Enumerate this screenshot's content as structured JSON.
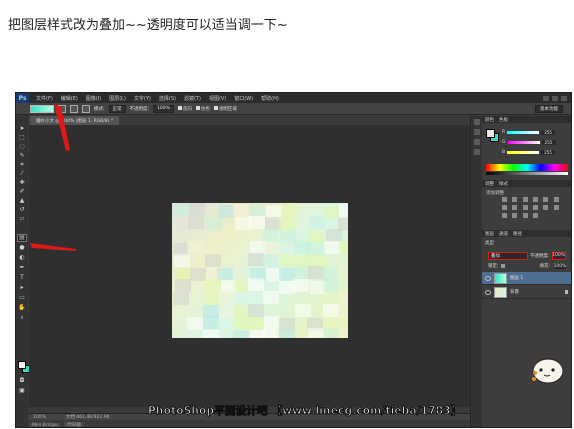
{
  "instruction_text": "把图层样式改为叠加~~透明度可以适当调一下~",
  "photoshop": {
    "logo": "Ps",
    "menu": [
      "文件(F)",
      "编辑(E)",
      "图像(I)",
      "图层(L)",
      "文字(Y)",
      "选择(S)",
      "滤镜(T)",
      "视图(V)",
      "窗口(W)",
      "帮助(H)"
    ],
    "options": {
      "mode_label": "模式:",
      "mode_value": "正常",
      "opacity_label": "不透明度:",
      "opacity_value": "100%",
      "reverse_label": "反向",
      "dither_label": "仿色",
      "transparency_label": "透明区域",
      "workspace": "基本功能"
    },
    "document_tab": "婚纱小文 @ 100% (图层 1, RGB/8) *",
    "status": {
      "zoom": "100%",
      "doc": "文档:461.4K/922.9K"
    },
    "bottom_tabs": [
      "Mini Bridge",
      "时间轴"
    ],
    "color_panel": {
      "tabs": [
        "颜色",
        "色板"
      ],
      "channels": [
        {
          "label": "R",
          "value": "255",
          "color": "#ff4b4b"
        },
        {
          "label": "G",
          "value": "255",
          "color": "#4bd44b"
        },
        {
          "label": "B",
          "value": "255",
          "color": "#4b6bff"
        }
      ]
    },
    "adjust_panel": {
      "tabs": [
        "调整",
        "样式"
      ],
      "title": "添加调整"
    },
    "layers_panel": {
      "tabs": [
        "图层",
        "通道",
        "路径"
      ],
      "kind_label": "类型",
      "blend_mode": "叠加",
      "opacity_label": "不透明度:",
      "opacity_value": "100%",
      "lock_label": "锁定:",
      "fill_label": "填充:",
      "fill_value": "100%",
      "layers": [
        {
          "name": "图层 1",
          "selected": true
        },
        {
          "name": "背景",
          "selected": false
        }
      ]
    }
  },
  "footer": "PhotoShop平面设计吧 【www.linecg.com/tieba/1783】",
  "accent_colors": {
    "arrow_red": "#e01818",
    "gradient_start": "#39e0c6",
    "gradient_end": "#b4ffe6"
  }
}
